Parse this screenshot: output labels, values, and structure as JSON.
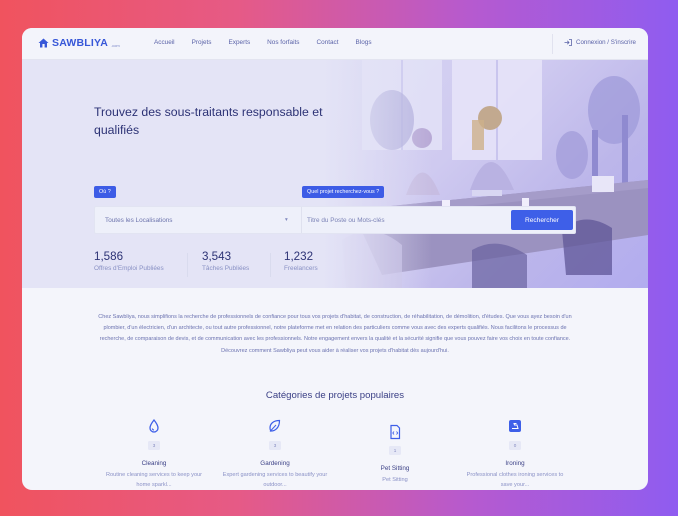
{
  "brand": {
    "name": "SAWBLIYA",
    "tld": ".com"
  },
  "nav": {
    "items": [
      "Accueil",
      "Projets",
      "Experts",
      "Nos forfaits",
      "Contact",
      "Blogs"
    ],
    "login_label": "Connexion / S'inscrire"
  },
  "hero": {
    "title": "Trouvez des sous-traitants responsable et qualifiés",
    "where_chip": "Où ?",
    "what_chip": "Quel projet recherchez-vous ?",
    "location_value": "Toutes les Localisations",
    "title_placeholder": "Titre du Poste ou Mots-clés",
    "search_label": "Rechercher"
  },
  "stats": [
    {
      "value": "1,586",
      "label": "Offres d'Emploi Publiées"
    },
    {
      "value": "3,543",
      "label": "Tâches Publiées"
    },
    {
      "value": "1,232",
      "label": "Freelancers"
    }
  ],
  "about": "Chez Sawbliya, nous simplifions la recherche de professionnels de confiance pour tous vos projets d'habitat, de construction, de réhabilitation, de démolition, d'études. Que vous ayez besoin d'un plombier, d'un électricien, d'un architecte, ou tout autre professionnel, notre plateforme met en relation des particuliers comme vous avec des experts qualifiés. Nous facilitons le processus de recherche, de comparaison de devis, et de communication avec les professionnels. Notre engagement envers la qualité et la sécurité signifie que vous pouvez faire vos choix en toute confiance. Découvrez comment Sawbliya peut vous aider à réaliser vos projets d'habitat dès aujourd'hui.",
  "categories": {
    "title": "Catégories de projets populaires",
    "items": [
      {
        "icon": "water-drop-icon",
        "count": "3",
        "name": "Cleaning",
        "desc": "Routine cleaning services to keep your home sparkl..."
      },
      {
        "icon": "leaf-icon",
        "count": "3",
        "name": "Gardening",
        "desc": "Expert gardening services to beautify your outdoor..."
      },
      {
        "icon": "code-file-icon",
        "count": "1",
        "name": "Pet Sitting",
        "desc": "Pet Sitting"
      },
      {
        "icon": "iron-icon",
        "count": "0",
        "name": "Ironing",
        "desc": "Professional clothes ironing services to save your..."
      }
    ]
  },
  "colors": {
    "accent": "#3e5fe8",
    "text_dark": "#2c3275",
    "text_muted": "#8890c4"
  }
}
